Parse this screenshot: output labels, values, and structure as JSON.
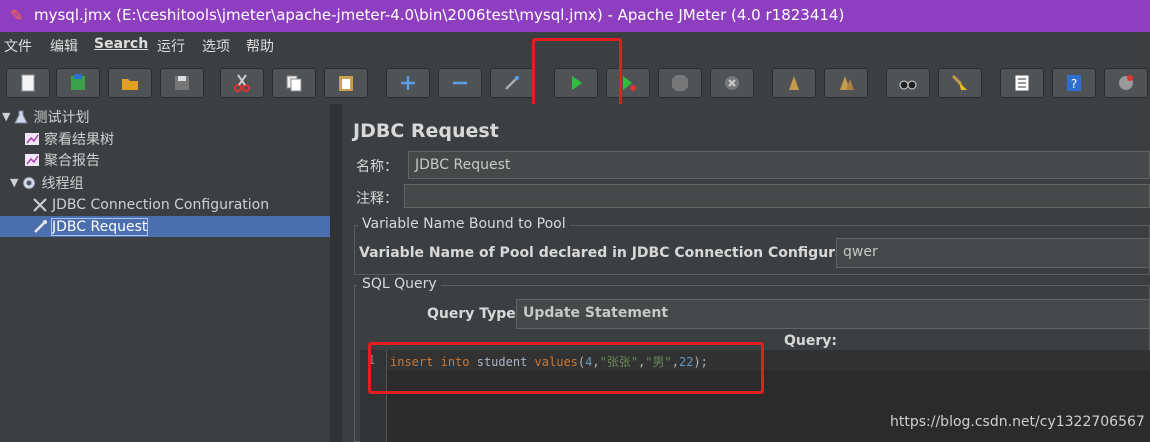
{
  "window": {
    "title": "mysql.jmx (E:\\ceshitools\\jmeter\\apache-jmeter-4.0\\bin\\2006test\\mysql.jmx) - Apache JMeter (4.0 r1823414)"
  },
  "menu": [
    "文件",
    "编辑",
    "Search",
    "运行",
    "选项",
    "帮助"
  ],
  "tree": {
    "items": [
      {
        "label": "测试计划"
      },
      {
        "label": "察看结果树"
      },
      {
        "label": "聚合报告"
      },
      {
        "label": "线程组"
      },
      {
        "label": "JDBC Connection Configuration"
      },
      {
        "label": "JDBC Request"
      }
    ]
  },
  "panel": {
    "title": "JDBC Request",
    "name_label": "名称：",
    "name_value": "JDBC Request",
    "comment_label": "注释：",
    "pool_group_title": "Variable Name Bound to Pool",
    "pool_label": "Variable Name of Pool declared in JDBC Connection Configuration:",
    "pool_value": "qwer",
    "sql_group_title": "SQL Query",
    "query_type_label": "Query Type:",
    "query_type_value": "Update Statement",
    "query_label": "Query:",
    "line_number": "1",
    "code": {
      "kw1": "insert",
      "kw2": "into",
      "table": "student",
      "values_kw": "values",
      "open": "(",
      "n1": "4",
      "c1": ",",
      "s1": "\"张张\"",
      "c2": ",",
      "s2": "\"男\"",
      "c3": ",",
      "n2": "22",
      "close": ");"
    }
  },
  "watermark": "https://blog.csdn.net/cy1322706567"
}
